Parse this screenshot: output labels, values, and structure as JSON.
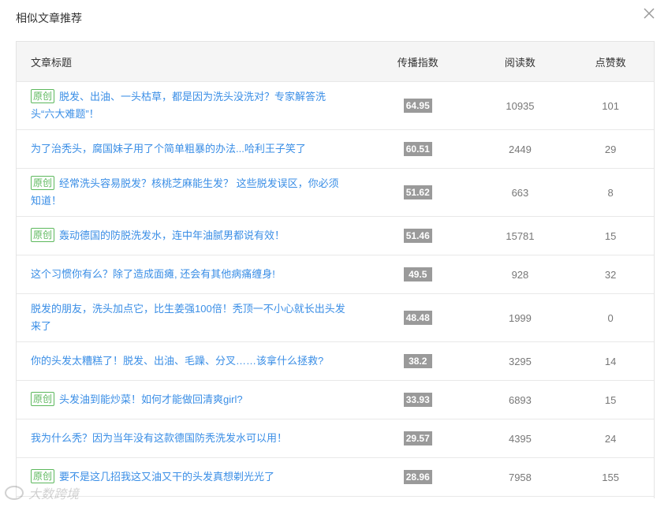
{
  "dialog": {
    "title": "相似文章推荐"
  },
  "table": {
    "headers": {
      "title": "文章标题",
      "index": "传播指数",
      "read": "阅读数",
      "like": "点赞数"
    },
    "badge_label": "原创",
    "rows": [
      {
        "original": true,
        "tall": true,
        "title": "脱发、出油、一头枯草，都是因为洗头没洗对？专家解答洗头“六大难题”！",
        "index": "64.95",
        "read": "10935",
        "like": "101"
      },
      {
        "original": false,
        "tall": false,
        "title": "为了治秃头，腐国妹子用了个简单粗暴的办法...哈利王子笑了",
        "index": "60.51",
        "read": "2449",
        "like": "29"
      },
      {
        "original": true,
        "tall": true,
        "title": "经常洗头容易脱发？核桃芝麻能生发？ 这些脱发误区，你必须知道！",
        "index": "51.62",
        "read": "663",
        "like": "8"
      },
      {
        "original": true,
        "tall": false,
        "title": "轰动德国的防脱洗发水，连中年油腻男都说有效！",
        "index": "51.46",
        "read": "15781",
        "like": "15"
      },
      {
        "original": false,
        "tall": false,
        "title": "这个习惯你有么？除了造成面瘫, 还会有其他病痛缠身!",
        "index": "49.5",
        "read": "928",
        "like": "32"
      },
      {
        "original": false,
        "tall": true,
        "title": "脱发的朋友，洗头加点它，比生姜强100倍！秃顶一不小心就长出头发来了",
        "index": "48.48",
        "read": "1999",
        "like": "0"
      },
      {
        "original": false,
        "tall": false,
        "title": "你的头发太糟糕了！脱发、出油、毛躁、分叉……该拿什么拯救?",
        "index": "38.2",
        "read": "3295",
        "like": "14"
      },
      {
        "original": true,
        "tall": false,
        "title": "头发油到能炒菜！如何才能做回清爽girl?",
        "index": "33.93",
        "read": "6893",
        "like": "15"
      },
      {
        "original": false,
        "tall": false,
        "title": "我为什么秃？因为当年没有这款德国防秃洗发水可以用！",
        "index": "29.57",
        "read": "4395",
        "like": "24"
      },
      {
        "original": true,
        "tall": false,
        "title": "要不是这几招我这又油又干的头发真想剃光光了",
        "index": "28.96",
        "read": "7958",
        "like": "155"
      }
    ]
  },
  "icons": {
    "close": "close-icon"
  },
  "watermark": {
    "text": "大数跨境"
  },
  "colors": {
    "link": "#3a8ee6",
    "badge": "#5cb85c",
    "score_bg": "#9a9a9a"
  }
}
